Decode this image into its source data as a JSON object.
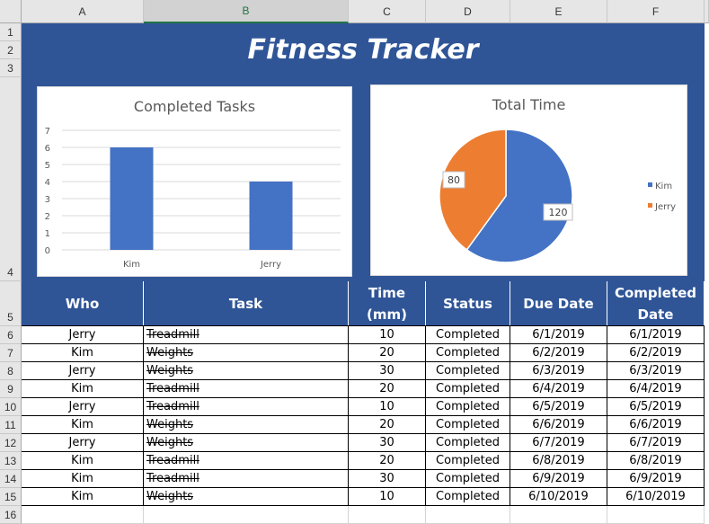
{
  "columns": [
    "A",
    "B",
    "C",
    "D",
    "E",
    "F"
  ],
  "selected_column": "B",
  "rows": [
    "1",
    "2",
    "3",
    "4",
    "5",
    "6",
    "7",
    "8",
    "9",
    "10",
    "11",
    "12",
    "13",
    "14",
    "15",
    "16"
  ],
  "title": "Fitness Tracker",
  "chart_data": [
    {
      "type": "bar",
      "title": "Completed Tasks",
      "categories": [
        "Kim",
        "Jerry"
      ],
      "values": [
        6,
        4
      ],
      "ylim": [
        0,
        7
      ],
      "yticks": [
        "0",
        "1",
        "2",
        "3",
        "4",
        "5",
        "6",
        "7"
      ],
      "grid": true,
      "color": "#4472c4"
    },
    {
      "type": "pie",
      "title": "Total Time",
      "categories": [
        "Kim",
        "Jerry"
      ],
      "values": [
        120,
        80
      ],
      "labels": [
        "120",
        "80"
      ],
      "colors": [
        "#4472c4",
        "#ed7d31"
      ],
      "legend": "right"
    }
  ],
  "table": {
    "headers": [
      "Who",
      "Task",
      "Time (mm)",
      "Status",
      "Due Date",
      "Completed Date"
    ],
    "rows": [
      [
        "Jerry",
        "Treadmill",
        "10",
        "Completed",
        "6/1/2019",
        "6/1/2019"
      ],
      [
        "Kim",
        "Weights",
        "20",
        "Completed",
        "6/2/2019",
        "6/2/2019"
      ],
      [
        "Jerry",
        "Weights",
        "30",
        "Completed",
        "6/3/2019",
        "6/3/2019"
      ],
      [
        "Kim",
        "Treadmill",
        "20",
        "Completed",
        "6/4/2019",
        "6/4/2019"
      ],
      [
        "Jerry",
        "Treadmill",
        "10",
        "Completed",
        "6/5/2019",
        "6/5/2019"
      ],
      [
        "Kim",
        "Weights",
        "20",
        "Completed",
        "6/6/2019",
        "6/6/2019"
      ],
      [
        "Jerry",
        "Weights",
        "30",
        "Completed",
        "6/7/2019",
        "6/7/2019"
      ],
      [
        "Kim",
        "Treadmill",
        "20",
        "Completed",
        "6/8/2019",
        "6/8/2019"
      ],
      [
        "Kim",
        "Treadmill",
        "30",
        "Completed",
        "6/9/2019",
        "6/9/2019"
      ],
      [
        "Kim",
        "Weights",
        "10",
        "Completed",
        "6/10/2019",
        "6/10/2019"
      ]
    ]
  }
}
